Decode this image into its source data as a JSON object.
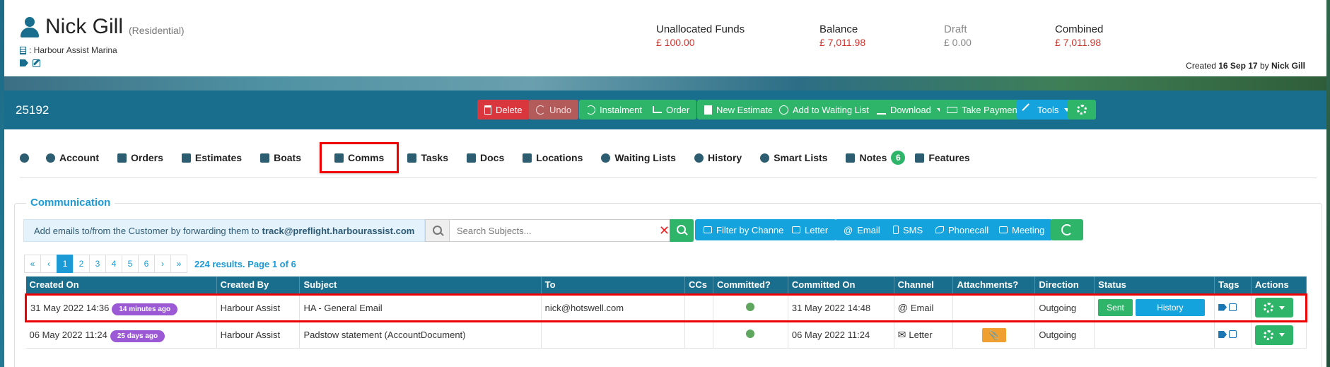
{
  "customer": {
    "name": "Nick Gill",
    "type": "(Residential)",
    "marina": ": Harbour Assist Marina",
    "created_prefix": "Created",
    "created_date": "16 Sep 17",
    "created_by_prefix": "by",
    "created_by": "Nick Gill"
  },
  "funds": [
    {
      "label": "Unallocated Funds",
      "value": "£ 100.00"
    },
    {
      "label": "Balance",
      "value": "£ 7,011.98"
    },
    {
      "label": "Draft",
      "value": "£ 0.00"
    },
    {
      "label": "Combined",
      "value": "£ 7,011.98"
    }
  ],
  "account_number": "25192",
  "toolbar": {
    "delete": "Delete",
    "undo": "Undo",
    "instalment": "Instalment",
    "order": "Order",
    "new_estimate": "New Estimate",
    "add_waiting": "Add to Waiting List",
    "download": "Download",
    "take_payment": "Take Payment",
    "tools": "Tools"
  },
  "tabs": [
    {
      "label": "Account"
    },
    {
      "label": "Orders"
    },
    {
      "label": "Estimates"
    },
    {
      "label": "Boats"
    },
    {
      "label": "Comms"
    },
    {
      "label": "Tasks"
    },
    {
      "label": "Docs"
    },
    {
      "label": "Locations"
    },
    {
      "label": "Waiting Lists"
    },
    {
      "label": "History"
    },
    {
      "label": "Smart Lists"
    },
    {
      "label": "Notes",
      "badge": "6"
    },
    {
      "label": "Features"
    }
  ],
  "communication": {
    "title": "Communication",
    "forward_text": "Add emails to/from the Customer by forwarding them to",
    "forward_email": "track@preflight.harbourassist.com",
    "search_placeholder": "Search Subjects...",
    "filter_channel": "Filter by Channel",
    "letter": "Letter",
    "email": "Email",
    "sms": "SMS",
    "phonecall": "Phonecall",
    "meeting": "Meeting"
  },
  "pager": {
    "first": "«",
    "prev": "‹",
    "pages": [
      "1",
      "2",
      "3",
      "4",
      "5",
      "6"
    ],
    "next": "›",
    "last": "»",
    "info": "224 results. Page 1 of 6"
  },
  "table": {
    "columns": [
      "Created On",
      "Created By",
      "Subject",
      "To",
      "CCs",
      "Committed?",
      "Committed On",
      "Channel",
      "Attachments?",
      "Direction",
      "Status",
      "Tags",
      "Actions"
    ],
    "rows": [
      {
        "created_on": "31 May 2022 14:36",
        "ago": "14 minutes ago",
        "created_by": "Harbour Assist",
        "subject": "HA - General Email",
        "to": "nick@hotswell.com",
        "committed_on": "31 May 2022 14:48",
        "channel_icon": "@",
        "channel": "Email",
        "direction": "Outgoing",
        "status": "Sent",
        "history": "History"
      },
      {
        "created_on": "06 May 2022 11:24",
        "ago": "25 days ago",
        "created_by": "Harbour Assist",
        "subject": "Padstow statement (AccountDocument)",
        "to": "",
        "committed_on": "06 May 2022 11:24",
        "channel_icon": "✉",
        "channel": "Letter",
        "direction": "Outgoing",
        "attachment_icon": "📎"
      }
    ]
  },
  "colors": {
    "teal": "#1a6e8d",
    "green": "#2fb56a",
    "blue": "#15a3de",
    "red": "#d9363e",
    "badge_purple": "#9b59d6",
    "highlight_red": "#ee0000"
  }
}
